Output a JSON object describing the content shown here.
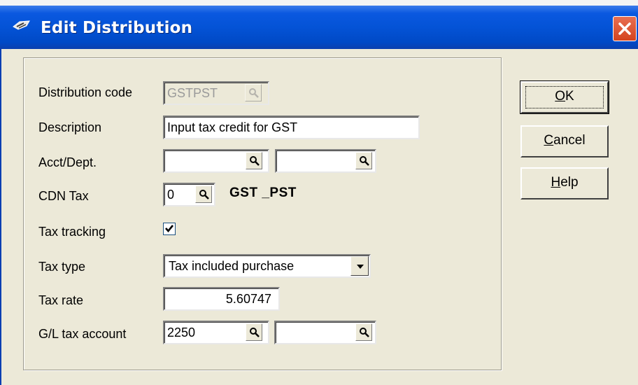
{
  "window": {
    "title": "Edit Distribution"
  },
  "form": {
    "distribution_code": {
      "label": "Distribution code",
      "value": "GSTPST"
    },
    "description": {
      "label": "Description",
      "value": "Input tax credit for GST"
    },
    "acct_dept": {
      "label": "Acct/Dept.",
      "value1": "",
      "value2": ""
    },
    "cdn_tax": {
      "label": "CDN Tax",
      "value": "0",
      "name": "GST _PST"
    },
    "tax_tracking": {
      "label": "Tax tracking",
      "checked": true
    },
    "tax_type": {
      "label": "Tax type",
      "value": "Tax included purchase"
    },
    "tax_rate": {
      "label": "Tax rate",
      "value": "5.60747"
    },
    "gl_tax_account": {
      "label": "G/L tax account",
      "value1": "2250",
      "value2": ""
    }
  },
  "buttons": {
    "ok": {
      "mnemonic": "O",
      "rest": "K"
    },
    "cancel": {
      "mnemonic": "C",
      "rest": "ancel"
    },
    "help": {
      "mnemonic": "H",
      "rest": "elp"
    }
  },
  "icons": {
    "lookup": "magnifier-icon",
    "dropdown": "chevron-down-icon",
    "close": "close-icon",
    "app": "app-icon"
  },
  "colors": {
    "titlebar": "#0453d6",
    "close": "#d4441f",
    "face": "#ece9d8"
  }
}
